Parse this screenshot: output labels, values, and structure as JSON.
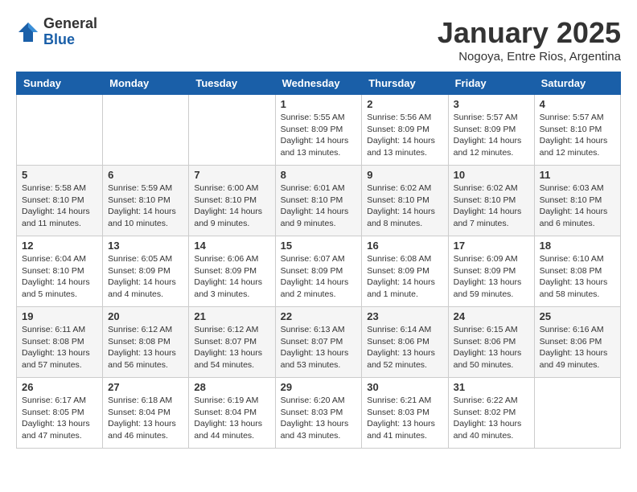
{
  "header": {
    "logo_general": "General",
    "logo_blue": "Blue",
    "month_title": "January 2025",
    "location": "Nogoya, Entre Rios, Argentina"
  },
  "calendar": {
    "days_of_week": [
      "Sunday",
      "Monday",
      "Tuesday",
      "Wednesday",
      "Thursday",
      "Friday",
      "Saturday"
    ],
    "weeks": [
      [
        {
          "day": "",
          "info": ""
        },
        {
          "day": "",
          "info": ""
        },
        {
          "day": "",
          "info": ""
        },
        {
          "day": "1",
          "info": "Sunrise: 5:55 AM\nSunset: 8:09 PM\nDaylight: 14 hours\nand 13 minutes."
        },
        {
          "day": "2",
          "info": "Sunrise: 5:56 AM\nSunset: 8:09 PM\nDaylight: 14 hours\nand 13 minutes."
        },
        {
          "day": "3",
          "info": "Sunrise: 5:57 AM\nSunset: 8:09 PM\nDaylight: 14 hours\nand 12 minutes."
        },
        {
          "day": "4",
          "info": "Sunrise: 5:57 AM\nSunset: 8:10 PM\nDaylight: 14 hours\nand 12 minutes."
        }
      ],
      [
        {
          "day": "5",
          "info": "Sunrise: 5:58 AM\nSunset: 8:10 PM\nDaylight: 14 hours\nand 11 minutes."
        },
        {
          "day": "6",
          "info": "Sunrise: 5:59 AM\nSunset: 8:10 PM\nDaylight: 14 hours\nand 10 minutes."
        },
        {
          "day": "7",
          "info": "Sunrise: 6:00 AM\nSunset: 8:10 PM\nDaylight: 14 hours\nand 9 minutes."
        },
        {
          "day": "8",
          "info": "Sunrise: 6:01 AM\nSunset: 8:10 PM\nDaylight: 14 hours\nand 9 minutes."
        },
        {
          "day": "9",
          "info": "Sunrise: 6:02 AM\nSunset: 8:10 PM\nDaylight: 14 hours\nand 8 minutes."
        },
        {
          "day": "10",
          "info": "Sunrise: 6:02 AM\nSunset: 8:10 PM\nDaylight: 14 hours\nand 7 minutes."
        },
        {
          "day": "11",
          "info": "Sunrise: 6:03 AM\nSunset: 8:10 PM\nDaylight: 14 hours\nand 6 minutes."
        }
      ],
      [
        {
          "day": "12",
          "info": "Sunrise: 6:04 AM\nSunset: 8:10 PM\nDaylight: 14 hours\nand 5 minutes."
        },
        {
          "day": "13",
          "info": "Sunrise: 6:05 AM\nSunset: 8:09 PM\nDaylight: 14 hours\nand 4 minutes."
        },
        {
          "day": "14",
          "info": "Sunrise: 6:06 AM\nSunset: 8:09 PM\nDaylight: 14 hours\nand 3 minutes."
        },
        {
          "day": "15",
          "info": "Sunrise: 6:07 AM\nSunset: 8:09 PM\nDaylight: 14 hours\nand 2 minutes."
        },
        {
          "day": "16",
          "info": "Sunrise: 6:08 AM\nSunset: 8:09 PM\nDaylight: 14 hours\nand 1 minute."
        },
        {
          "day": "17",
          "info": "Sunrise: 6:09 AM\nSunset: 8:09 PM\nDaylight: 13 hours\nand 59 minutes."
        },
        {
          "day": "18",
          "info": "Sunrise: 6:10 AM\nSunset: 8:08 PM\nDaylight: 13 hours\nand 58 minutes."
        }
      ],
      [
        {
          "day": "19",
          "info": "Sunrise: 6:11 AM\nSunset: 8:08 PM\nDaylight: 13 hours\nand 57 minutes."
        },
        {
          "day": "20",
          "info": "Sunrise: 6:12 AM\nSunset: 8:08 PM\nDaylight: 13 hours\nand 56 minutes."
        },
        {
          "day": "21",
          "info": "Sunrise: 6:12 AM\nSunset: 8:07 PM\nDaylight: 13 hours\nand 54 minutes."
        },
        {
          "day": "22",
          "info": "Sunrise: 6:13 AM\nSunset: 8:07 PM\nDaylight: 13 hours\nand 53 minutes."
        },
        {
          "day": "23",
          "info": "Sunrise: 6:14 AM\nSunset: 8:06 PM\nDaylight: 13 hours\nand 52 minutes."
        },
        {
          "day": "24",
          "info": "Sunrise: 6:15 AM\nSunset: 8:06 PM\nDaylight: 13 hours\nand 50 minutes."
        },
        {
          "day": "25",
          "info": "Sunrise: 6:16 AM\nSunset: 8:06 PM\nDaylight: 13 hours\nand 49 minutes."
        }
      ],
      [
        {
          "day": "26",
          "info": "Sunrise: 6:17 AM\nSunset: 8:05 PM\nDaylight: 13 hours\nand 47 minutes."
        },
        {
          "day": "27",
          "info": "Sunrise: 6:18 AM\nSunset: 8:04 PM\nDaylight: 13 hours\nand 46 minutes."
        },
        {
          "day": "28",
          "info": "Sunrise: 6:19 AM\nSunset: 8:04 PM\nDaylight: 13 hours\nand 44 minutes."
        },
        {
          "day": "29",
          "info": "Sunrise: 6:20 AM\nSunset: 8:03 PM\nDaylight: 13 hours\nand 43 minutes."
        },
        {
          "day": "30",
          "info": "Sunrise: 6:21 AM\nSunset: 8:03 PM\nDaylight: 13 hours\nand 41 minutes."
        },
        {
          "day": "31",
          "info": "Sunrise: 6:22 AM\nSunset: 8:02 PM\nDaylight: 13 hours\nand 40 minutes."
        },
        {
          "day": "",
          "info": ""
        }
      ]
    ]
  }
}
